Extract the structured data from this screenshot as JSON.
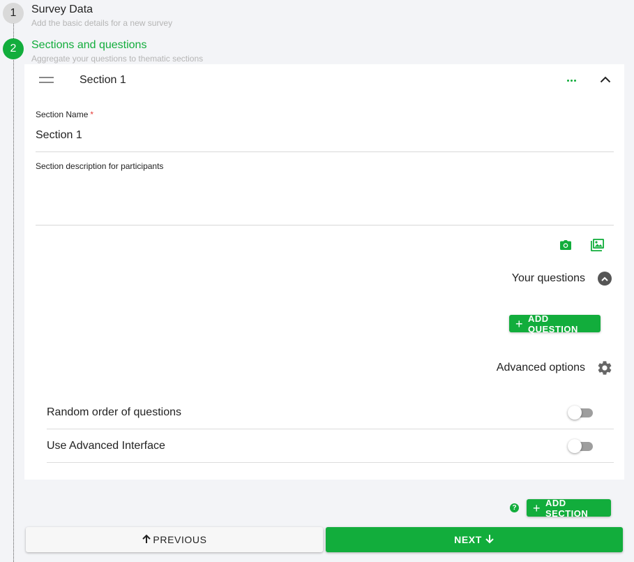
{
  "stepper": {
    "steps": [
      {
        "number": "1",
        "title": "Survey Data",
        "subtitle": "Add the basic details for a new survey",
        "state": "inactive"
      },
      {
        "number": "2",
        "title": "Sections and questions",
        "subtitle": "Aggregate your questions to thematic sections",
        "state": "active"
      }
    ]
  },
  "section": {
    "header_title": "Section 1",
    "name_label": "Section Name",
    "name_required_mark": "*",
    "name_value": "Section 1",
    "description_label": "Section description for participants",
    "description_value": "",
    "questions_label": "Your questions",
    "add_question_label": "ADD QUESTION",
    "advanced_label": "Advanced options",
    "options": [
      {
        "label": "Random order of questions",
        "enabled": false
      },
      {
        "label": "Use Advanced Interface",
        "enabled": false
      }
    ]
  },
  "footer": {
    "help_glyph": "?",
    "add_section_label": "ADD SECTION",
    "previous_label": "PREVIOUS",
    "next_label": "NEXT"
  },
  "colors": {
    "accent": "#12ad3c",
    "inactive_step": "#d9d9d9",
    "background": "#f3f4f7",
    "required": "#e53935"
  },
  "icons": {
    "drag_handle": "drag-handle-icon",
    "more": "more-horizontal-icon",
    "collapse": "chevron-up-icon",
    "camera": "camera-icon",
    "image": "image-icon",
    "settings": "gear-icon",
    "add": "plus-icon",
    "previous": "arrow-up-icon",
    "next": "arrow-down-icon",
    "help": "help-icon"
  }
}
